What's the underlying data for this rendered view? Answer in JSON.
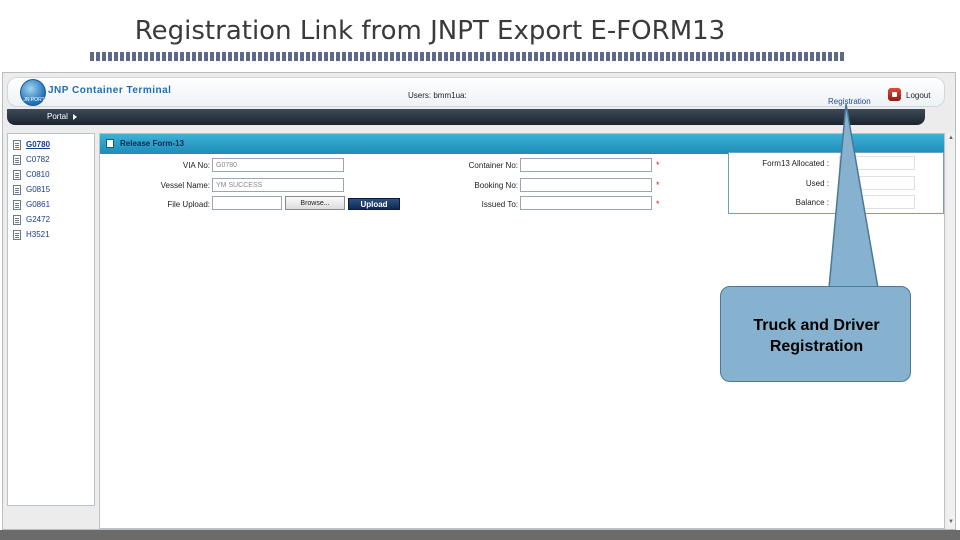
{
  "slide": {
    "title": "Registration Link from JNPT Export E-FORM13"
  },
  "header": {
    "app_name": "JNP Container Terminal",
    "logo_text": "JN PORT",
    "users_label": "Users: bmm1ua:",
    "registration_link": "Registration",
    "logout_label": "Logout"
  },
  "nav": {
    "tab_label": "Portal"
  },
  "sidebar": {
    "items": [
      {
        "label": "G0780"
      },
      {
        "label": "C0782"
      },
      {
        "label": "C0810"
      },
      {
        "label": "G0815"
      },
      {
        "label": "G0861"
      },
      {
        "label": "G2472"
      },
      {
        "label": "H3521"
      }
    ]
  },
  "panel": {
    "title": "Release Form-13",
    "via_label": "VIA No:",
    "via_value": "G0780",
    "vessel_label": "Vessel Name:",
    "vessel_value": "YM SUCCESS",
    "file_label": "File Upload:",
    "browse_label": "Browse...",
    "upload_label": "Upload",
    "container_label": "Container No:",
    "booking_label": "Booking No:",
    "issued_label": "Issued To:",
    "required_mark": "*",
    "allocated_label": "Form13 Allocated :",
    "used_label": "Used :",
    "balance_label": "Balance :"
  },
  "callout": {
    "line1": "Truck and Driver",
    "line2": "Registration"
  },
  "colors": {
    "panel_header": "#1d8db8",
    "nav_bar": "#1a2430",
    "callout_fill": "#86b2cf",
    "link_blue": "#1e4e8c"
  }
}
